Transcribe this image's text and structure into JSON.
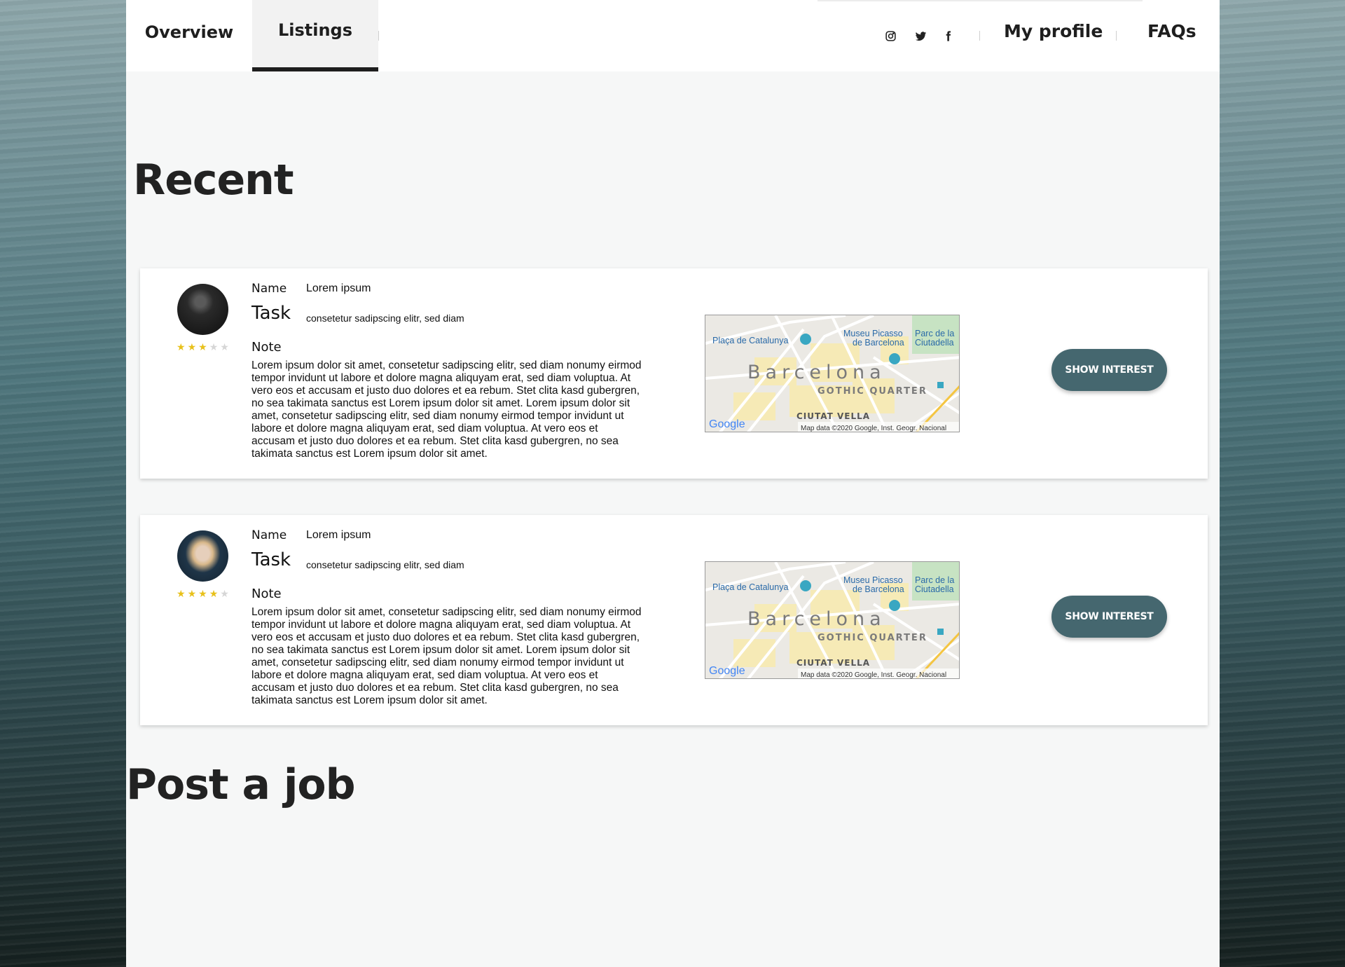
{
  "nav": {
    "tabs": [
      "Overview",
      "Listings"
    ],
    "active_tab": "Listings",
    "social_icons": [
      "instagram-icon",
      "twitter-icon",
      "facebook-icon"
    ],
    "links": [
      "My profile",
      "FAQs"
    ]
  },
  "sections": {
    "recent_title": "Recent",
    "post_title": "Post a job"
  },
  "listings": [
    {
      "name_label": "Name",
      "name_value": "Lorem ipsum",
      "task_label": "Task",
      "task_value": "consetetur sadipscing elitr, sed diam",
      "note_label": "Note",
      "note_text": "Lorem ipsum dolor sit amet, consetetur sadipscing elitr, sed diam nonumy eirmod tempor invidunt ut labore et dolore magna aliquyam erat, sed diam voluptua. At vero eos et accusam et justo duo dolores et ea rebum. Stet clita kasd gubergren, no sea takimata sanctus est Lorem ipsum dolor sit amet. Lorem ipsum dolor sit amet, consetetur sadipscing elitr, sed diam nonumy eirmod tempor invidunt ut labore et dolore magna aliquyam erat, sed diam voluptua. At vero eos et accusam et justo duo dolores et ea rebum. Stet clita kasd gubergren, no sea takimata sanctus est Lorem ipsum dolor sit amet.",
      "rating": 3,
      "rating_max": 5,
      "button_label": "SHOW INTEREST",
      "map": {
        "city": "Barcelona",
        "labels": [
          "Plaça de Catalunya",
          "Museu Picasso",
          "de Barcelona",
          "Parc de la",
          "Ciutadella",
          "GOTHIC QUARTER",
          "CIUTAT VELLA"
        ],
        "brand": "Google",
        "attribution": "Map data ©2020 Google, Inst. Geogr. Nacional"
      }
    },
    {
      "name_label": "Name",
      "name_value": "Lorem ipsum",
      "task_label": "Task",
      "task_value": "consetetur sadipscing elitr, sed diam",
      "note_label": "Note",
      "note_text": "Lorem ipsum dolor sit amet, consetetur sadipscing elitr, sed diam nonumy eirmod tempor invidunt ut labore et dolore magna aliquyam erat, sed diam voluptua. At vero eos et accusam et justo duo dolores et ea rebum. Stet clita kasd gubergren, no sea takimata sanctus est Lorem ipsum dolor sit amet. Lorem ipsum dolor sit amet, consetetur sadipscing elitr, sed diam nonumy eirmod tempor invidunt ut labore et dolore magna aliquyam erat, sed diam voluptua. At vero eos et accusam et justo duo dolores et ea rebum. Stet clita kasd gubergren, no sea takimata sanctus est Lorem ipsum dolor sit amet.",
      "rating": 4,
      "rating_max": 5,
      "button_label": "SHOW INTEREST",
      "map": {
        "city": "Barcelona",
        "labels": [
          "Plaça de Catalunya",
          "Museu Picasso",
          "de Barcelona",
          "Parc de la",
          "Ciutadella",
          "GOTHIC QUARTER",
          "CIUTAT VELLA"
        ],
        "brand": "Google",
        "attribution": "Map data ©2020 Google, Inst. Geogr. Nacional"
      }
    }
  ],
  "colors": {
    "button_bg": "#45676f",
    "star_on": "#e8c11b",
    "star_off": "#d6d6d6",
    "page_bg": "#f6f7f7",
    "text_dark": "#1e1e1e"
  }
}
